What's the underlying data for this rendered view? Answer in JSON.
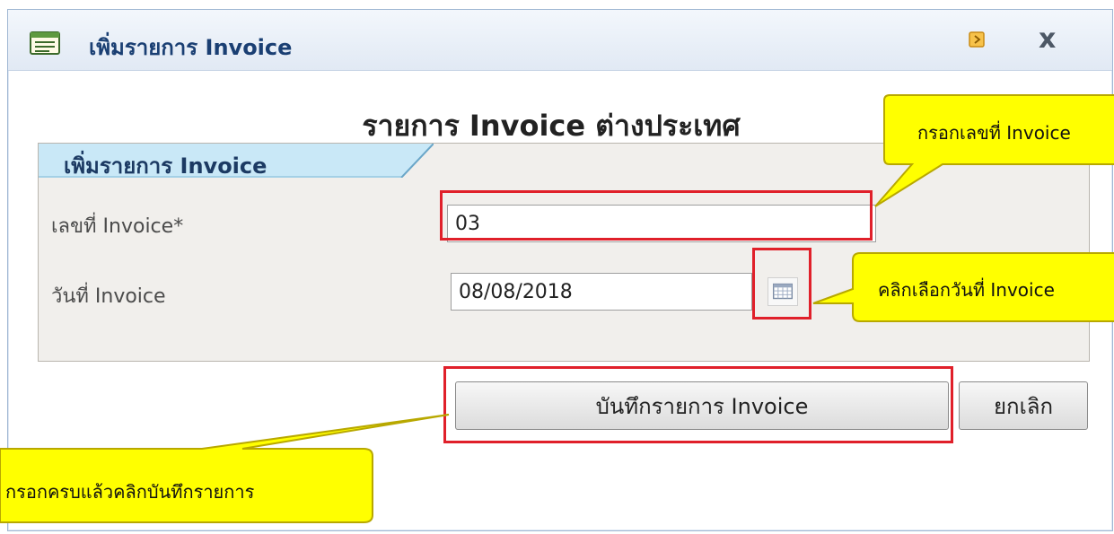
{
  "window": {
    "title": "เพิ่มรายการ Invoice",
    "icons": {
      "app": "form-icon",
      "minimize": "minimize-icon",
      "close": "close-icon"
    },
    "close_glyph": "x"
  },
  "form": {
    "heading": "รายการ Invoice ต่างประเทศ",
    "section_title": "เพิ่มรายการ Invoice",
    "fields": {
      "invoice_no": {
        "label": "เลขที่ Invoice*",
        "value": "03"
      },
      "invoice_date": {
        "label": "วันที่ Invoice",
        "value": "08/08/2018",
        "calendar_icon": "calendar-icon"
      }
    }
  },
  "buttons": {
    "save": "บันทึกรายการ Invoice",
    "cancel": "ยกเลิก"
  },
  "callouts": {
    "invoice_no": "กรอกเลขที่ Invoice",
    "invoice_date": "คลิกเลือกวันที่ Invoice",
    "save": "กรอกครบแล้วคลิกบันทึกรายการ"
  },
  "colors": {
    "callout_fill": "#ffff00",
    "highlight": "#e0202a",
    "title_text": "#1a3f73"
  }
}
